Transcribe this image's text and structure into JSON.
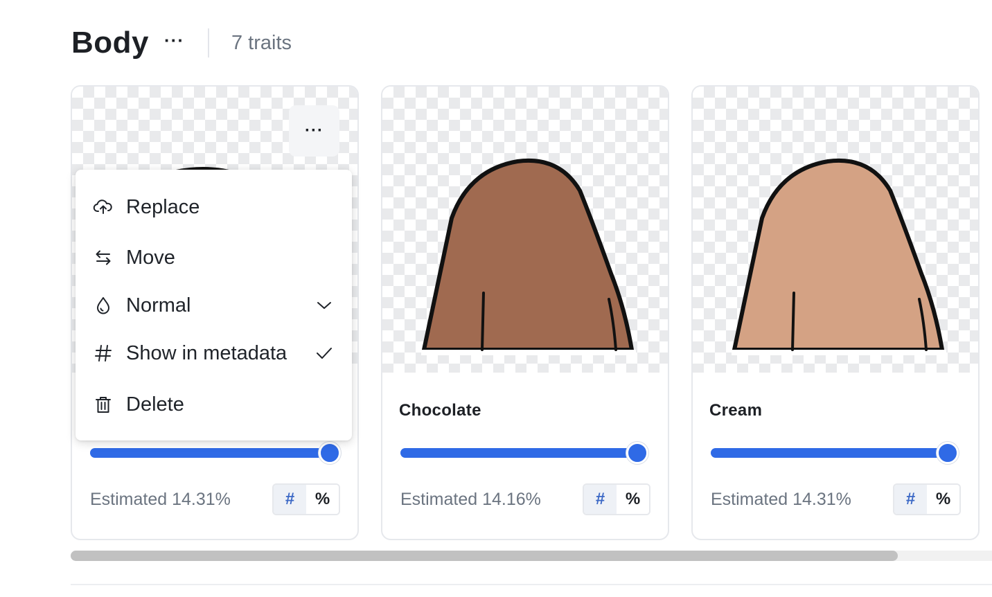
{
  "section": {
    "title": "Body",
    "more_label": "···",
    "trait_count": "7 traits"
  },
  "cards": [
    {
      "name": "",
      "color": "#3b3b3b",
      "rarity_fill": 1.0,
      "estimate": "Estimated 14.31%",
      "toggle_hash": "#",
      "toggle_percent": "%",
      "more_label": "···"
    },
    {
      "name": "Chocolate",
      "color": "#a06a50",
      "rarity_fill": 1.0,
      "estimate": "Estimated 14.16%",
      "toggle_hash": "#",
      "toggle_percent": "%"
    },
    {
      "name": "Cream",
      "color": "#d4a284",
      "rarity_fill": 1.0,
      "estimate": "Estimated 14.31%",
      "toggle_hash": "#",
      "toggle_percent": "%"
    }
  ],
  "menu": {
    "items": [
      {
        "label": "Replace",
        "icon": "cloud-upload-icon"
      },
      {
        "label": "Move",
        "icon": "swap-arrows-icon"
      },
      {
        "label": "Normal",
        "icon": "droplet-icon",
        "trailing": "chevron-down-icon"
      },
      {
        "label": "Show in metadata",
        "icon": "hash-icon",
        "trailing": "check-icon"
      },
      {
        "label": "Delete",
        "icon": "trash-icon"
      }
    ]
  },
  "colors": {
    "accent": "#2f6ae6",
    "outline": "#111111"
  }
}
